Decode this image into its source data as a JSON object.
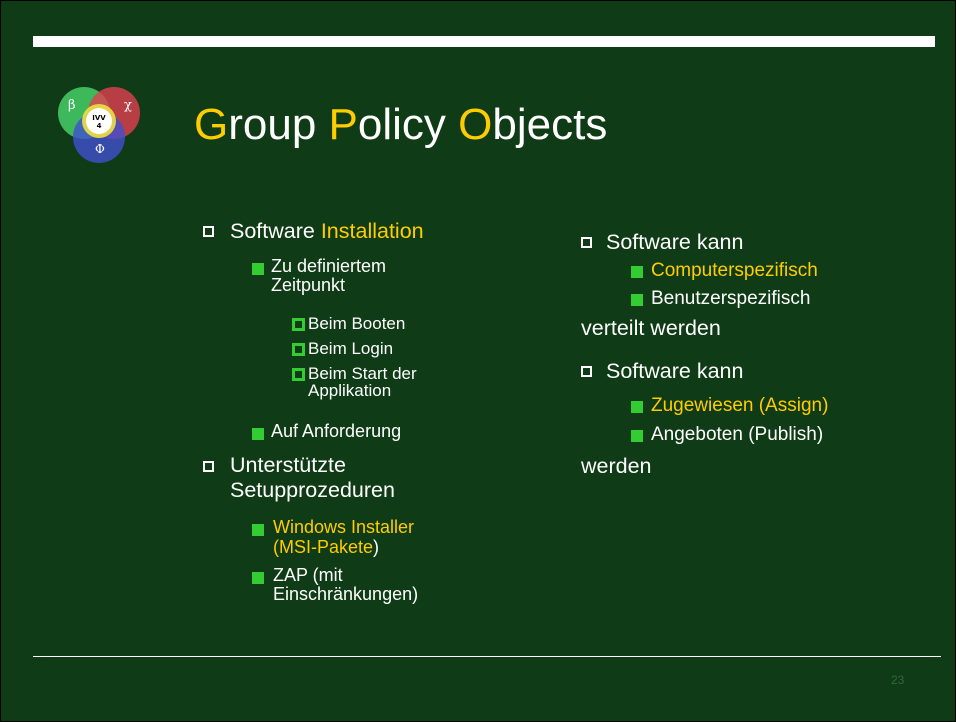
{
  "title": {
    "part1_initial": "G",
    "part1_rest": "roup ",
    "part2_initial": "P",
    "part2_rest": "olicy ",
    "part3_initial": "O",
    "part3_rest": "bjects"
  },
  "logo": {
    "greek_beta": "β",
    "greek_chi": "χ",
    "greek_phi": "Φ",
    "center_top": "IVV",
    "center_bottom": "4"
  },
  "left": {
    "item1": {
      "prefix": "Software ",
      "highlight": "Installation"
    },
    "item1_sub1_line1": "Zu definiertem",
    "item1_sub1_line2": "Zeitpunkt",
    "item1_sub1_a": "Beim Booten",
    "item1_sub1_b": "Beim Login",
    "item1_sub1_c_line1": "Beim Start der",
    "item1_sub1_c_line2": "Applikation",
    "item1_sub2": "Auf Anforderung",
    "item2_line1": "Unterstützte",
    "item2_line2": "Setupprozeduren",
    "item2_sub1_line1": "Windows Installer",
    "item2_sub1_line2_highlight": "(MSI-Pakete",
    "item2_sub1_line2_rest": ")",
    "item2_sub2_line1": "ZAP (mit",
    "item2_sub2_line2": "Einschränkungen)"
  },
  "right": {
    "item1": "Software kann",
    "item1_sub1": "Computerspezifisch",
    "item1_sub2": "Benutzerspezifisch",
    "item1_tail": "verteilt werden",
    "item2": "Software kann",
    "item2_sub1": "Zugewiesen (Assign)",
    "item2_sub2": "Angeboten (Publish)",
    "item2_tail": "werden"
  },
  "page_number": "23",
  "colors": {
    "background": "#0f3b16",
    "accent": "#ffcc00",
    "bullet": "#33cc33",
    "text": "#ffffff"
  }
}
